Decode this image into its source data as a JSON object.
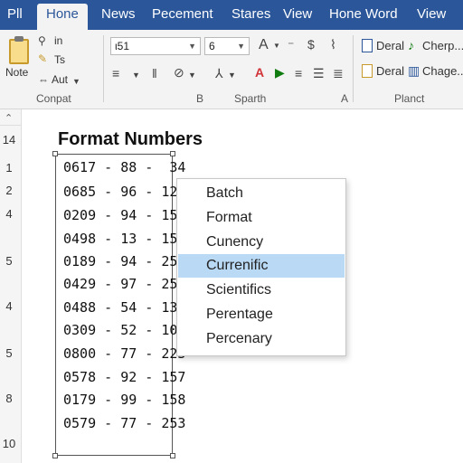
{
  "tabs": [
    {
      "label": "Pll",
      "active": false
    },
    {
      "label": "Hone",
      "active": true
    },
    {
      "label": "News",
      "active": false
    },
    {
      "label": "Pecement",
      "active": false
    },
    {
      "label": "Stares",
      "active": false
    },
    {
      "label": "View",
      "active": false
    },
    {
      "label": "Hone Word",
      "active": false
    },
    {
      "label": "View",
      "active": false
    }
  ],
  "ribbon": {
    "clipboard": {
      "paste_label": "Note",
      "copy_label": "in",
      "cut_label": "Ts",
      "autofit_label": "Aut",
      "group_label": "Conpat"
    },
    "font": {
      "font_name": "ι51",
      "font_size": "6",
      "group_label": "B"
    },
    "styles": {
      "group_label": "Sparth",
      "corner_label": "A"
    },
    "planct": {
      "item1": "Deral",
      "item2": "Cherp...",
      "item3": "Deral",
      "item4": "Chage...",
      "group_label": "Planct"
    }
  },
  "sheet": {
    "title": "Format Numbers",
    "row_numbers": [
      "14",
      "1",
      "2",
      "4",
      "",
      "5",
      "",
      "4",
      "",
      "5",
      "",
      "8",
      "",
      "10"
    ],
    "cells": [
      "0617 - 88 -  34",
      "0685 - 96 - 127",
      "0209 - 94 - 155",
      "0498 - 13 - 155",
      "0189 - 94 - 255",
      "0429 - 97 - 254",
      "0488 - 54 - 133",
      "0309 - 52 - 106",
      "0800 - 77 - 223",
      "0578 - 92 - 157",
      "0179 - 99 - 158",
      "0579 - 77 - 253"
    ]
  },
  "dropdown": {
    "items": [
      "Batch",
      "Format",
      "Cunency",
      "Currenific",
      "Scientifics",
      "Perentage",
      "Percenary"
    ],
    "highlighted_index": 3,
    "highlight_color": "#b9d9f5"
  },
  "colors": {
    "titlebar": "#2b579a",
    "ribbon": "#f3f3f3",
    "accent_red": "#d13438",
    "accent_green": "#107c10"
  }
}
